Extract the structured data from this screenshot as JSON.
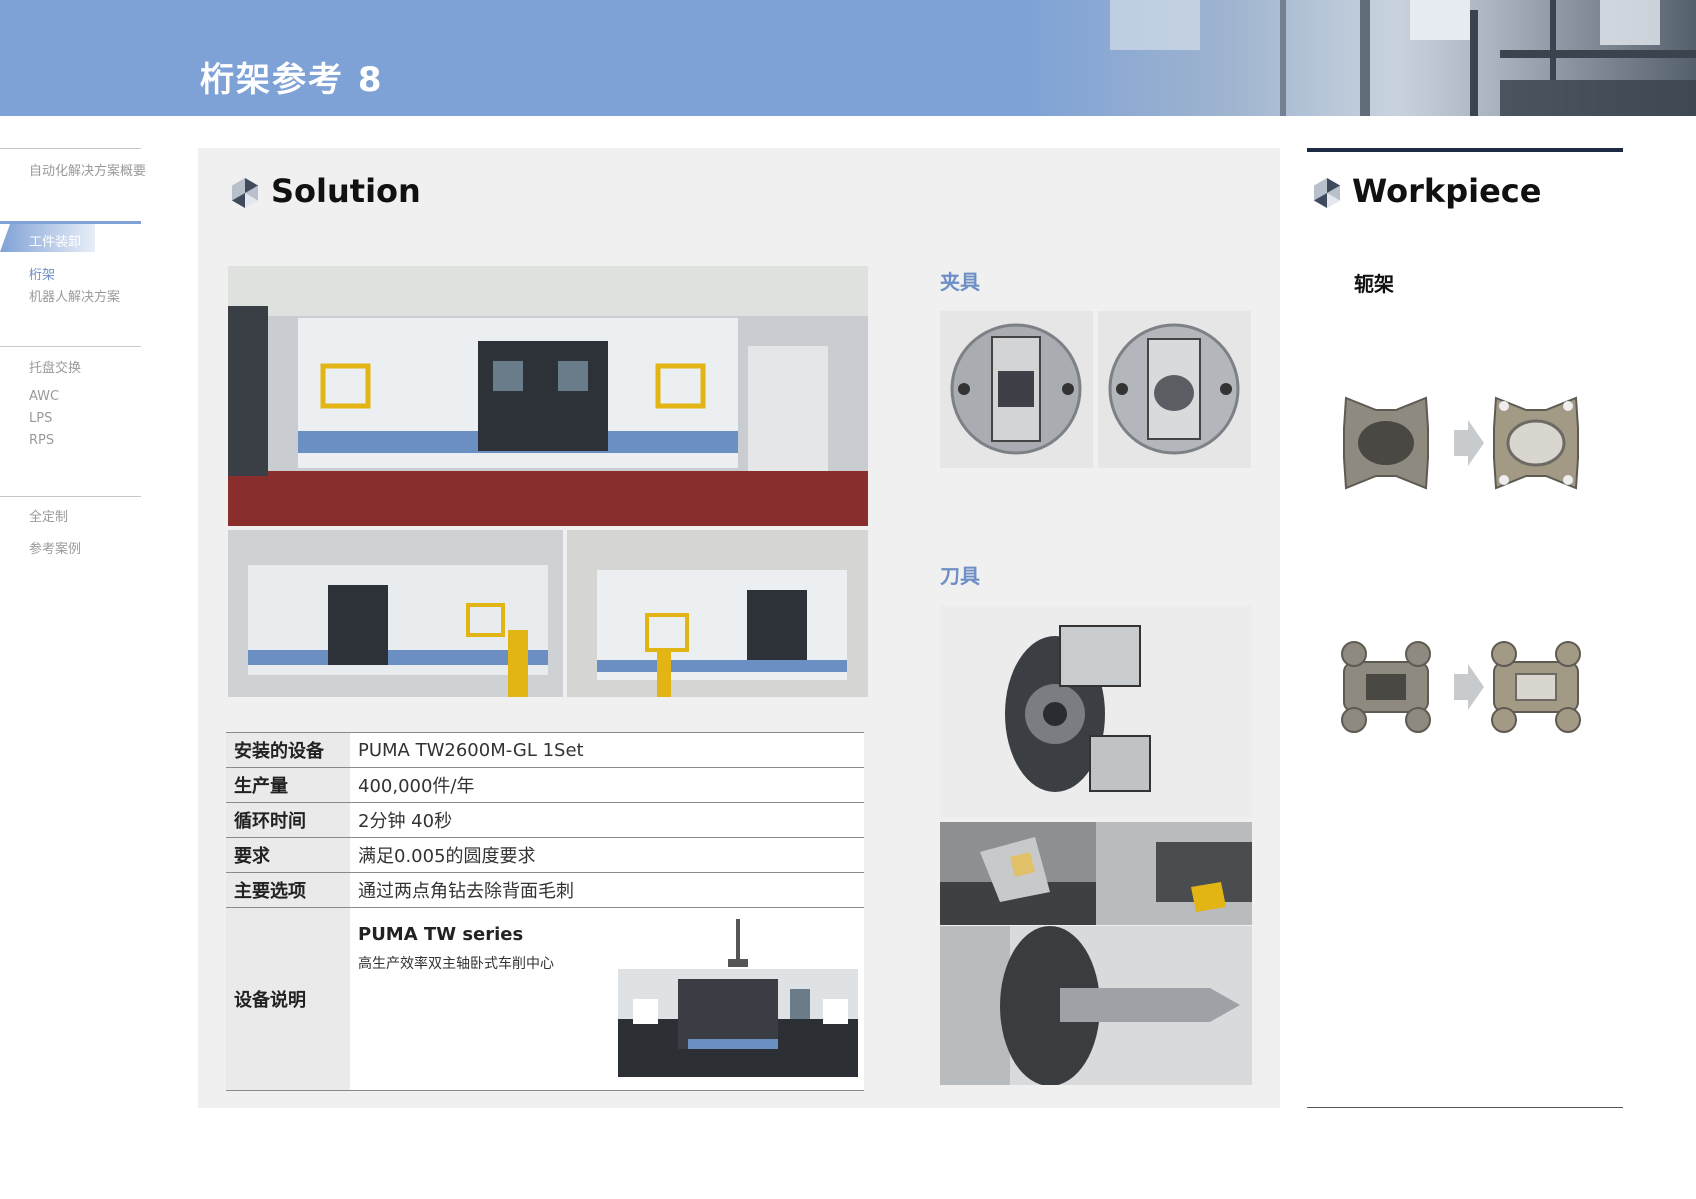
{
  "header": {
    "title": "桁架参考 8"
  },
  "sidebar": {
    "groups": [
      {
        "items": [
          "自动化解决方案概要"
        ]
      },
      {
        "active": "工件装卸",
        "items": [
          "桁架",
          "机器人解决方案"
        ]
      },
      {
        "items": [
          "托盘交换",
          "AWC",
          "LPS",
          "RPS"
        ]
      },
      {
        "items": [
          "全定制",
          "参考案例"
        ]
      }
    ]
  },
  "solution": {
    "title": "Solution",
    "fixture_label": "夹具",
    "tool_label": "刀具",
    "specs": [
      {
        "key": "安装的设备",
        "value": "PUMA TW2600M-GL 1Set"
      },
      {
        "key": "生产量",
        "value": "400,000件/年"
      },
      {
        "key": "循环时间",
        "value": "2分钟 40秒"
      },
      {
        "key": "要求",
        "value": "满足0.005的圆度要求"
      },
      {
        "key": "主要选项",
        "value": "通过两点角钻去除背面毛刺"
      }
    ],
    "equipment": {
      "key": "设备说明",
      "model": "PUMA TW series",
      "desc": "高生产效率双主轴卧式车削中心"
    }
  },
  "workpiece": {
    "title": "Workpiece",
    "label": "轭架"
  },
  "colors": {
    "accent": "#7fa2d6",
    "navy": "#1c2a44",
    "panel": "#f0f0f0"
  }
}
